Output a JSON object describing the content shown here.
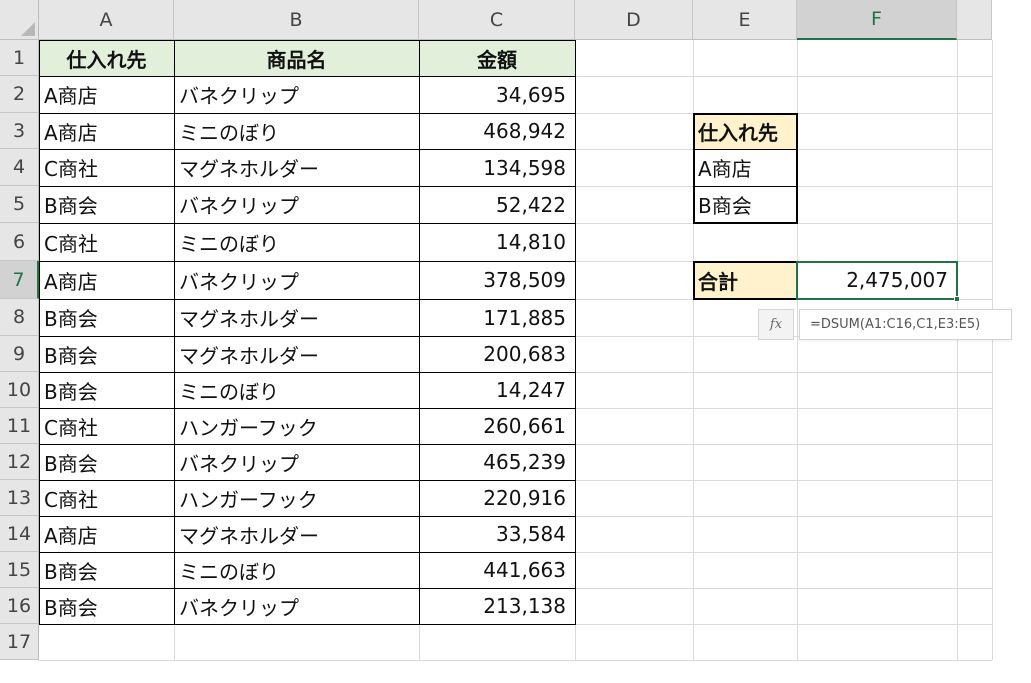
{
  "columns": [
    "A",
    "B",
    "C",
    "D",
    "E",
    "F"
  ],
  "rows": [
    "1",
    "2",
    "3",
    "4",
    "5",
    "6",
    "7",
    "8",
    "9",
    "10",
    "11",
    "12",
    "13",
    "14",
    "15",
    "16",
    "17"
  ],
  "selected": {
    "column": "F",
    "row": "7"
  },
  "table": {
    "headers": [
      "仕入れ先",
      "商品名",
      "金額"
    ],
    "rows": [
      [
        "A商店",
        "バネクリップ",
        "34,695"
      ],
      [
        "A商店",
        "ミニのぼり",
        "468,942"
      ],
      [
        "C商社",
        "マグネホルダー",
        "134,598"
      ],
      [
        "B商会",
        "バネクリップ",
        "52,422"
      ],
      [
        "C商社",
        "ミニのぼり",
        "14,810"
      ],
      [
        "A商店",
        "バネクリップ",
        "378,509"
      ],
      [
        "B商会",
        "マグネホルダー",
        "171,885"
      ],
      [
        "B商会",
        "マグネホルダー",
        "200,683"
      ],
      [
        "B商会",
        "ミニのぼり",
        "14,247"
      ],
      [
        "C商社",
        "ハンガーフック",
        "260,661"
      ],
      [
        "B商会",
        "バネクリップ",
        "465,239"
      ],
      [
        "C商社",
        "ハンガーフック",
        "220,916"
      ],
      [
        "A商店",
        "マグネホルダー",
        "33,584"
      ],
      [
        "B商会",
        "ミニのぼり",
        "441,663"
      ],
      [
        "B商会",
        "バネクリップ",
        "213,138"
      ]
    ]
  },
  "criteria": {
    "header": "仕入れ先",
    "values": [
      "A商店",
      "B商会"
    ]
  },
  "total": {
    "label": "合計",
    "value": "2,475,007"
  },
  "formula": {
    "icon": "fx",
    "text": "=DSUM(A1:C16,C1,E3:E5)"
  },
  "colors": {
    "header_fill": "#e2efda",
    "criteria_fill": "#fff2cc",
    "selection": "#217346"
  }
}
